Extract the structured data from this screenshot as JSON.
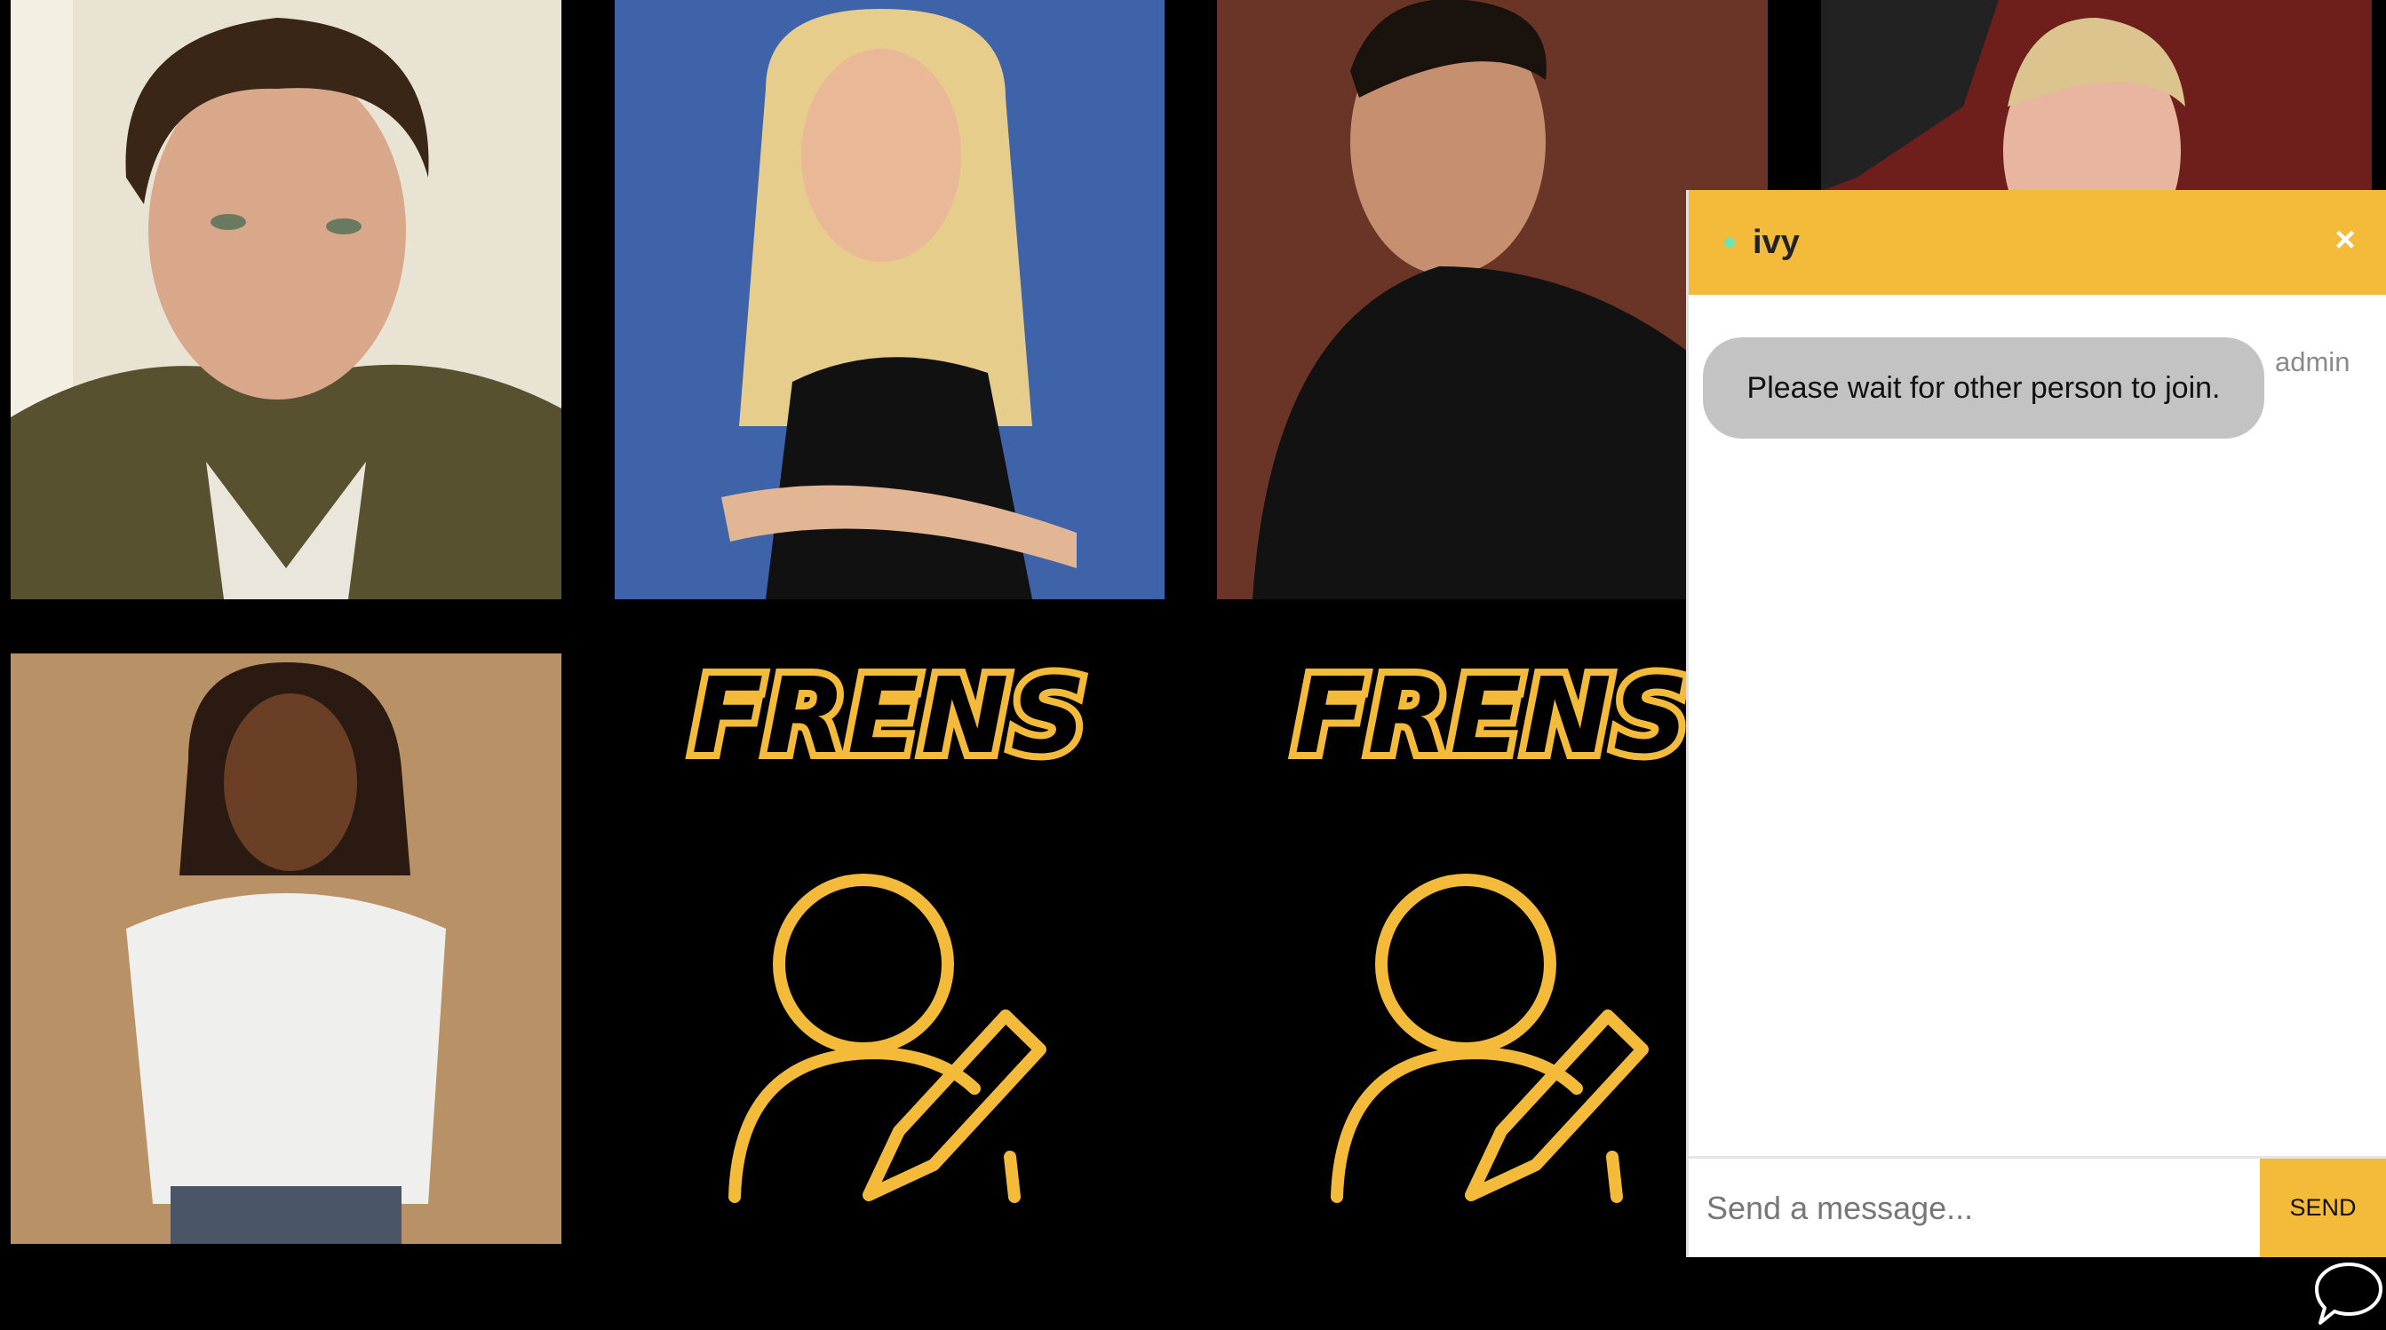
{
  "tiles": {
    "placeholder_logo_text": "FRENS"
  },
  "chat": {
    "user_name": "ivy",
    "close_label": "×",
    "messages": [
      {
        "text": "Please wait for other person to join.",
        "sender": "admin"
      }
    ],
    "input_placeholder": "Send a message...",
    "input_value": "",
    "send_label": "SEND"
  },
  "colors": {
    "accent": "#f4bb3b",
    "background": "#000000",
    "online": "#6fe3b0",
    "bubble": "#c3c3c3"
  },
  "icons": {
    "placeholder": "add-user-icon",
    "close": "close-icon",
    "chat_toggle": "chat-bubble-icon"
  }
}
